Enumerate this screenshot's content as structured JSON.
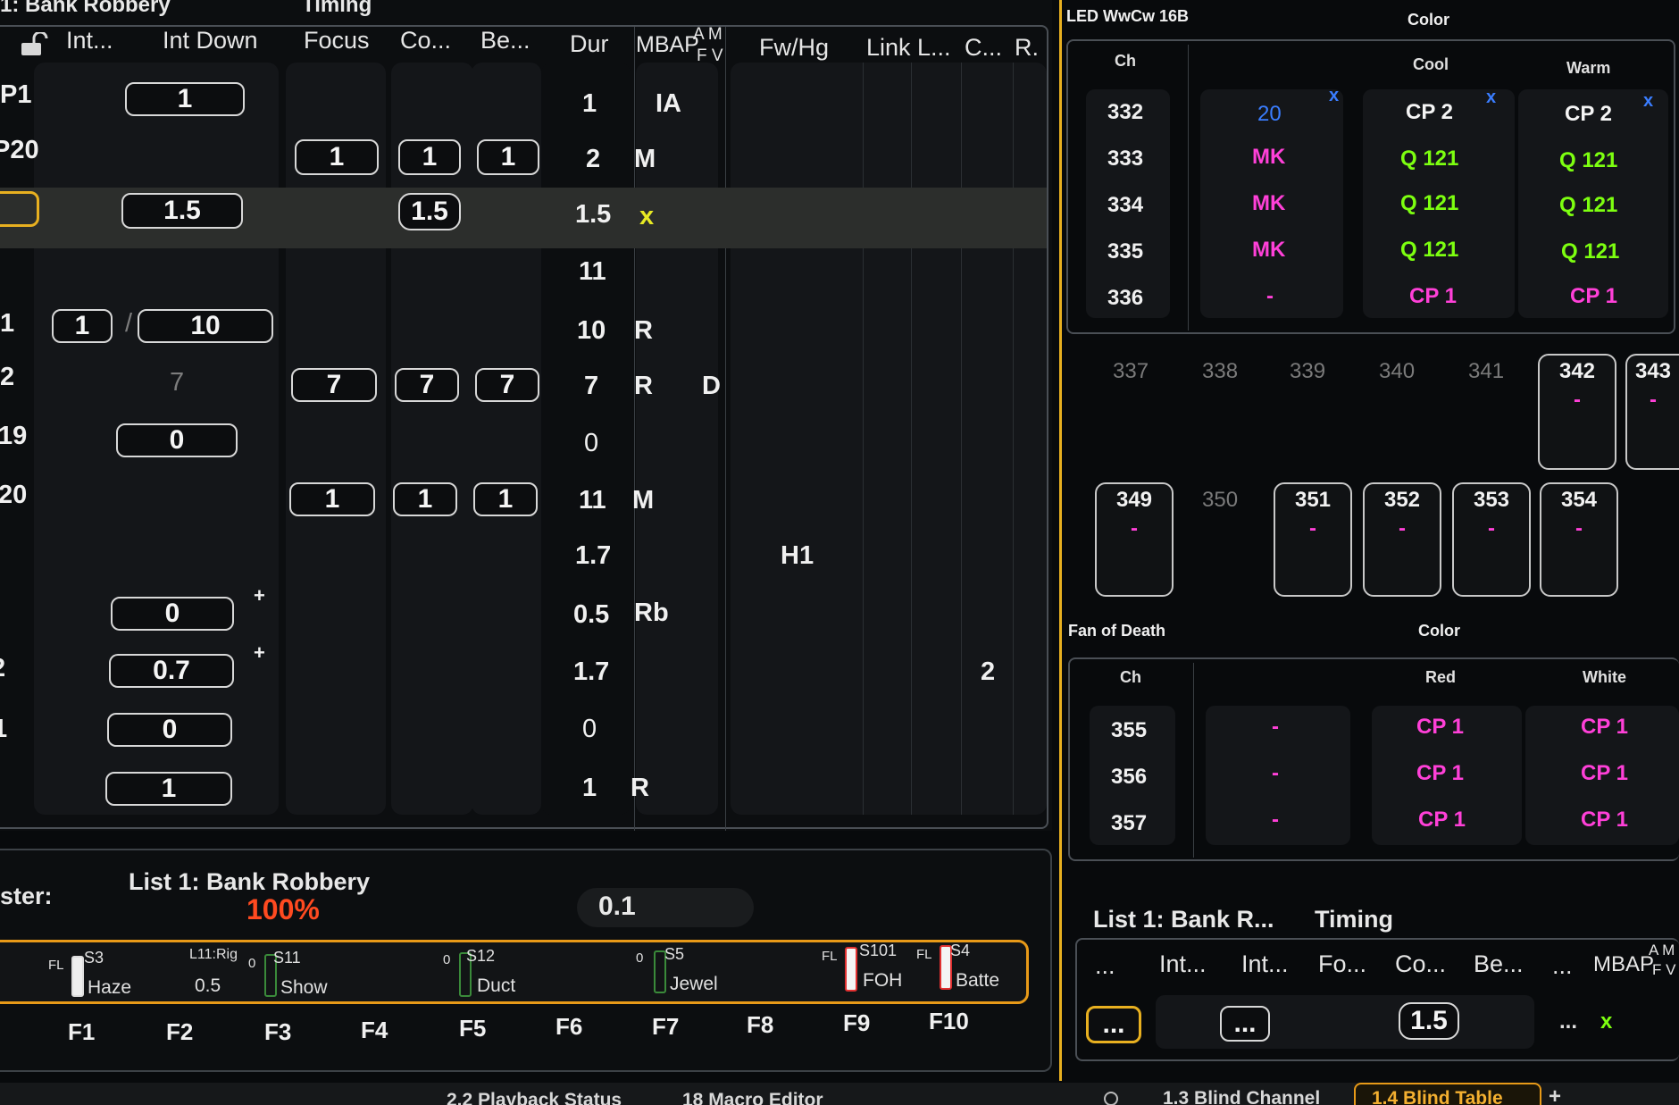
{
  "cue_list": {
    "title_partial": "1: Bank Robbery",
    "timing_label": "Timing",
    "headers": [
      "Int...",
      "Int Down",
      "Focus",
      "Co...",
      "Be...",
      "Dur",
      "MBAP",
      "A M",
      "F V",
      "Fw/Hg",
      "Link L...",
      "C...",
      "R."
    ],
    "rows": [
      {
        "label": "P1",
        "int_down": "1",
        "dur": "1",
        "mbap": "IA"
      },
      {
        "label": "P20",
        "focus": "1",
        "color": "1",
        "beam": "1",
        "dur": "2",
        "mbap": "M"
      },
      {
        "label": "",
        "int_down": "1.5",
        "color": "1.5",
        "dur": "1.5",
        "mbap": "x"
      },
      {
        "label": "",
        "dur": "11"
      },
      {
        "label": "1",
        "int": "1",
        "sep": "/",
        "int_down": "10",
        "dur": "10",
        "mbap": "R"
      },
      {
        "label": "2",
        "int_down": "7",
        "focus": "7",
        "color": "7",
        "beam": "7",
        "dur": "7",
        "mbap": "R",
        "fv": "D"
      },
      {
        "label": "19",
        "int_down": "0",
        "dur": "0"
      },
      {
        "label": "20",
        "focus": "1",
        "color": "1",
        "beam": "1",
        "dur": "11",
        "mbap": "M"
      },
      {
        "label": "",
        "dur": "1.7",
        "fwhg": "H1"
      },
      {
        "label": "",
        "int_down": "0",
        "plus": "+",
        "dur": "0.5",
        "mbap": "Rb"
      },
      {
        "label": "2",
        "int_down": "0.7",
        "plus": "+",
        "dur": "1.7",
        "c": "2"
      },
      {
        "label": "1",
        "int_down": "0",
        "dur": "0"
      },
      {
        "label": "",
        "int_down": "1",
        "dur": "1",
        "mbap": "R"
      }
    ]
  },
  "playback": {
    "label_partial": "ster:",
    "list_name": "List 1: Bank Robbery",
    "percent": "100%",
    "time_value": "0.1"
  },
  "faders": [
    {
      "prefix": "FL",
      "sub": "S3",
      "name": "Haze",
      "key": "F1"
    },
    {
      "prefix": "L11:Rig",
      "sub": "",
      "name": "0.5",
      "key": "F2"
    },
    {
      "prefix": "0",
      "sub": "S11",
      "name": "Show",
      "key": "F3"
    },
    {
      "prefix": "",
      "sub": "",
      "name": "",
      "key": "F4"
    },
    {
      "prefix": "0",
      "sub": "S12",
      "name": "Duct",
      "key": "F5"
    },
    {
      "prefix": "",
      "sub": "",
      "name": "",
      "key": "F6"
    },
    {
      "prefix": "0",
      "sub": "S5",
      "name": "Jewel",
      "key": "F7"
    },
    {
      "prefix": "",
      "sub": "",
      "name": "",
      "key": "F8"
    },
    {
      "prefix": "FL",
      "sub": "S101",
      "name": "FOH",
      "key": "F9"
    },
    {
      "prefix": "FL",
      "sub": "S4",
      "name": "Batte",
      "key": "F10"
    }
  ],
  "led_table": {
    "title": "LED WwCw 16B",
    "color_label": "Color",
    "headers": {
      "ch": "Ch",
      "cool": "Cool",
      "warm": "Warm"
    },
    "x_mark": "x",
    "rows": [
      {
        "ch": "332",
        "v1": "20",
        "cool": "CP 2",
        "warm": "CP 2"
      },
      {
        "ch": "333",
        "v1": "MK",
        "cool": "Q 121",
        "warm": "Q 121"
      },
      {
        "ch": "334",
        "v1": "MK",
        "cool": "Q 121",
        "warm": "Q 121"
      },
      {
        "ch": "335",
        "v1": "MK",
        "cool": "Q 121",
        "warm": "Q 121"
      },
      {
        "ch": "336",
        "v1": "-",
        "cool": "CP 1",
        "warm": "CP 1"
      }
    ]
  },
  "channel_row1": {
    "dim": [
      "337",
      "338",
      "339",
      "340",
      "341"
    ],
    "tiles": [
      {
        "ch": "342",
        "val": "-"
      },
      {
        "ch": "343",
        "val": "-"
      }
    ]
  },
  "channel_row2": {
    "tile0": {
      "ch": "349",
      "val": "-"
    },
    "dim": "350",
    "tiles": [
      {
        "ch": "351",
        "val": "-"
      },
      {
        "ch": "352",
        "val": "-"
      },
      {
        "ch": "353",
        "val": "-"
      },
      {
        "ch": "354",
        "val": "-"
      }
    ]
  },
  "fan_table": {
    "title": "Fan of Death",
    "color_label": "Color",
    "headers": {
      "ch": "Ch",
      "red": "Red",
      "white": "White"
    },
    "rows": [
      {
        "ch": "355",
        "v1": "-",
        "red": "CP 1",
        "white": "CP 1"
      },
      {
        "ch": "356",
        "v1": "-",
        "red": "CP 1",
        "white": "CP 1"
      },
      {
        "ch": "357",
        "v1": "-",
        "red": "CP 1",
        "white": "CP 1"
      }
    ]
  },
  "mini_list": {
    "title": "List 1: Bank R...",
    "timing": "Timing",
    "headers": [
      "...",
      "Int...",
      "Int...",
      "Fo...",
      "Co...",
      "Be...",
      "...",
      "MBAP",
      "A M",
      "F V"
    ],
    "row": {
      "b1": "...",
      "b2": "...",
      "b3": "1.5",
      "dots": "...",
      "x": "x"
    }
  },
  "tabs": [
    "2.2 Playback Status",
    "18 Macro Editor",
    "1.3 Blind Channel",
    "1.4 Blind Table",
    "+"
  ],
  "colors": {
    "pink": "#ff40d8",
    "green": "#7dff10",
    "blue": "#3a7dff",
    "orange_accent": "#e89a18",
    "percent": "#ff4a20"
  }
}
